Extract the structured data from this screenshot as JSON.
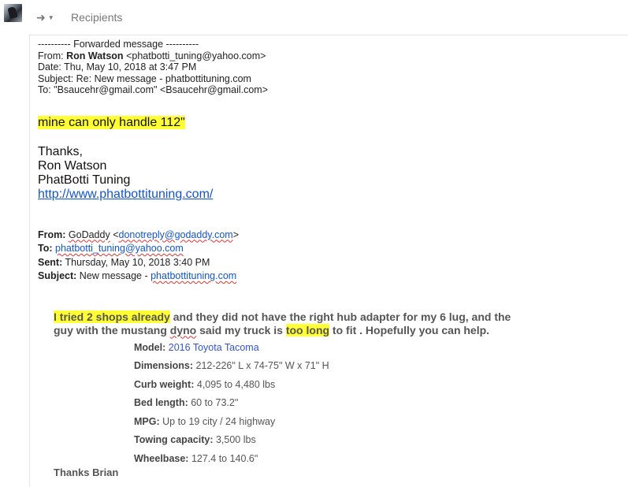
{
  "toolbar": {
    "reply_icon": "reply-arrow-icon",
    "recipients_label": "Recipients"
  },
  "forwarded": {
    "separator": "---------- Forwarded message ----------",
    "from_label": "From:",
    "from_name": "Ron Watson",
    "from_email": "<phatbotti_tuning@yahoo.com>",
    "date_line": "Date: Thu, May 10, 2018 at 3:47 PM",
    "subject_line": "Subject: Re: New message - phatbottituning.com",
    "to_line": "To: \"Bsaucehr@gmail.com\" <Bsaucehr@gmail.com>"
  },
  "reply": {
    "highlight_text": "mine can only handle 112\"",
    "thanks": "Thanks,",
    "name": "Ron Watson",
    "company": "PhatBotti Tuning",
    "url": "http://www.phatbottituning.com/"
  },
  "original": {
    "from_label": "From:",
    "from_name": "GoDaddy",
    "from_lt": "<",
    "from_email": "donotreply@godaddy.com",
    "from_gt": ">",
    "to_label": "To:",
    "to_email": "phatbotti_tuning@yahoo.com",
    "sent_label": "Sent:",
    "sent_value": "Thursday, May 10, 2018 3:40 PM",
    "subject_label": "Subject:",
    "subject_value": "New message - ",
    "subject_link": "phatbottituning.com"
  },
  "message": {
    "part1_hl": "I tried 2 shops already",
    "part2": " and they did not have the right hub adapter for my 6 lug, and the guy with the mustang ",
    "part3_spell": "dyno",
    "part4": " said my truck is ",
    "part5_hl": "too long",
    "part6": " to fit . Hopefully you can help."
  },
  "specs": [
    {
      "label": "Model:",
      "value": "2016 Toyota Tacoma"
    },
    {
      "label": "Dimensions:",
      "value": "212-226ʺ L x 74-75ʺ W x 71ʺ H"
    },
    {
      "label": "Curb weight:",
      "value": "4,095 to 4,480 lbs"
    },
    {
      "label": "Bed length:",
      "value": "60 to 73.2ʺ"
    },
    {
      "label": "MPG:",
      "value": "Up to 19 city / 24 highway"
    },
    {
      "label": "Towing capacity:",
      "value": "3,500 lbs"
    },
    {
      "label": "Wheelbase:",
      "value": "127.4 to 140.6ʺ"
    }
  ],
  "signoff": "Thanks Brian",
  "colors": {
    "highlight": "#ffff33",
    "link": "#1155cc",
    "muted_text": "#555555"
  }
}
